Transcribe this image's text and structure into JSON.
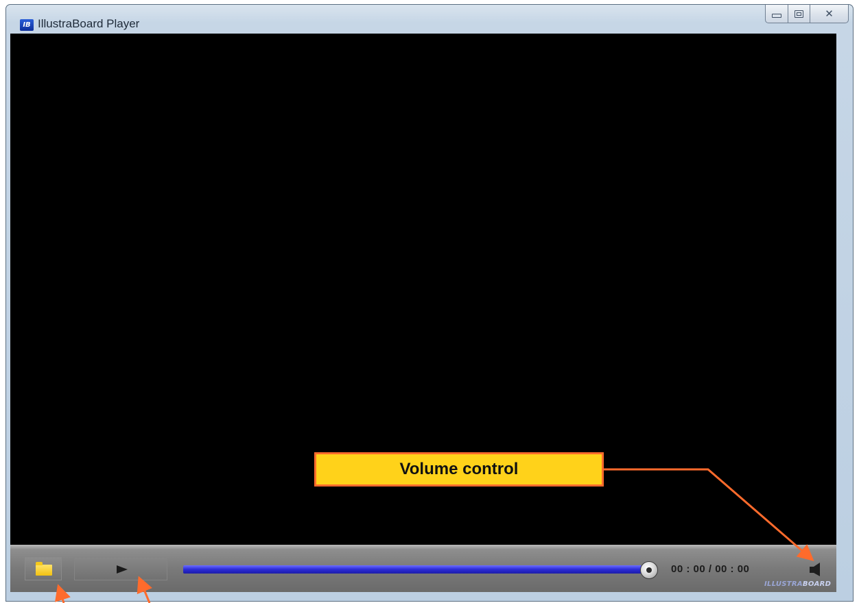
{
  "window": {
    "title": "IllustraBoard Player",
    "app_icon_text": "IB",
    "controls": {
      "minimize": "minimize-icon",
      "maximize": "restore-icon",
      "close": "close-icon",
      "close_glyph": "✕"
    }
  },
  "player": {
    "open_button_icon": "folder-icon",
    "play_button_icon": "play-icon",
    "seek_progress": 1.0,
    "time_display": "00 : 00 / 00 : 00",
    "volume_icon": "speaker-icon",
    "brand": {
      "part1": "ILLUSTRA",
      "part2": "BOARD"
    }
  },
  "annotation": {
    "label": "Volume control",
    "colors": {
      "fill": "#ffd21a",
      "border": "#ff6b2c",
      "arrow": "#ff6b2c"
    }
  }
}
